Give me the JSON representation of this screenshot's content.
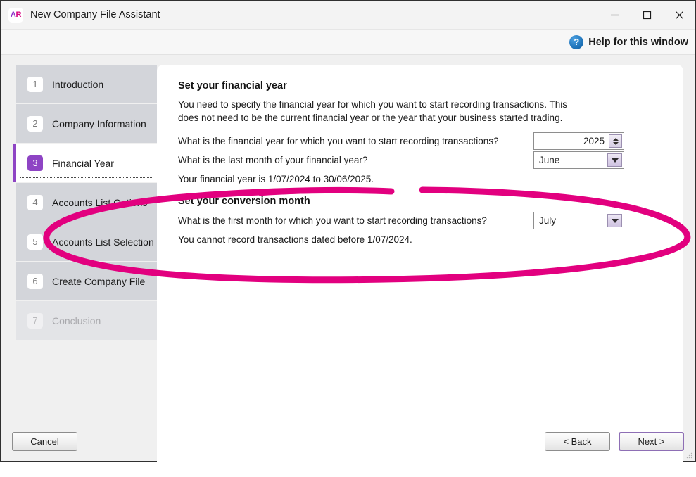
{
  "window": {
    "title": "New Company File Assistant",
    "logo_text_a": "A",
    "logo_text_r": "R",
    "minimize_icon": "minimize-icon",
    "maximize_icon": "maximize-icon",
    "close_icon": "close-icon"
  },
  "help": {
    "icon": "question-mark-circle-icon",
    "icon_glyph": "?",
    "label": "Help for this window"
  },
  "sidebar": {
    "items": [
      {
        "num": "1",
        "label": "Introduction",
        "state": "done"
      },
      {
        "num": "2",
        "label": "Company Information",
        "state": "done"
      },
      {
        "num": "3",
        "label": "Financial Year",
        "state": "active"
      },
      {
        "num": "4",
        "label": "Accounts List Options",
        "state": "done"
      },
      {
        "num": "5",
        "label": "Accounts List Selection",
        "state": "done"
      },
      {
        "num": "6",
        "label": "Create Company File",
        "state": "done"
      },
      {
        "num": "7",
        "label": "Conclusion",
        "state": "disabled"
      }
    ]
  },
  "main": {
    "financial_year": {
      "heading": "Set your financial year",
      "description": "You need to specify the financial year for which you want to start recording transactions. This does not need to be the current financial year or the year that your business started trading.",
      "year_question": "What is the financial year for which you want to start recording transactions?",
      "year_value": "2025",
      "last_month_question": "What is the last month of your financial year?",
      "last_month_value": "June",
      "summary": "Your financial year is 1/07/2024 to 30/06/2025."
    },
    "conversion_month": {
      "heading": "Set your conversion month",
      "question": "What is the first month for which you want to start recording transactions?",
      "value": "July",
      "note": "You cannot record transactions dated before 1/07/2024."
    }
  },
  "footer": {
    "cancel_label": "Cancel",
    "back_label": "< Back",
    "next_label": "Next >"
  },
  "annotation": {
    "shape": "hand-drawn-ellipse",
    "color": "#e2007f"
  },
  "colors": {
    "accent_purple": "#8e44c4",
    "logo_magenta": "#d6007f",
    "annotation_magenta": "#e2007f",
    "help_blue": "#1b6fb5",
    "sidebar_step_bg": "#d3d5da",
    "panel_bg": "#ffffff"
  }
}
